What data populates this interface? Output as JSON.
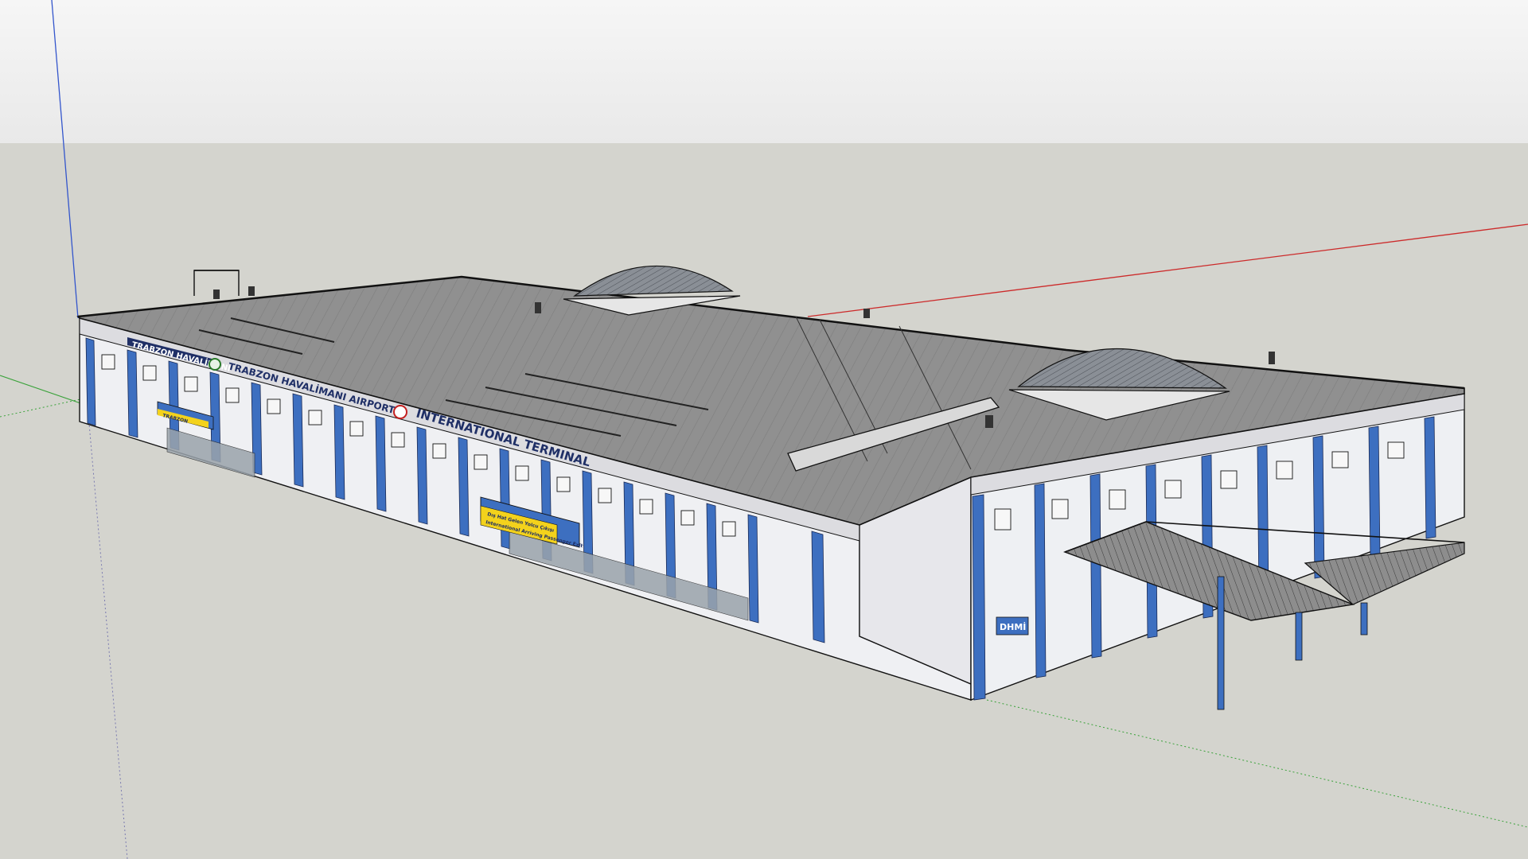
{
  "viewport": {
    "sky_color": "#eeeeee",
    "ground_color": "#d4d4ce"
  },
  "axes": {
    "red_axis_color": "#cc2a2a",
    "green_axis_color": "#3aa23a",
    "blue_axis_color": "#3355cc"
  },
  "colors": {
    "roof": "#8f8f8f",
    "roof_dark": "#7b7b7b",
    "wall_panel": "#f1f1f4",
    "wall_panel_shadow": "#d8d8dc",
    "column_blue": "#3d6fc0",
    "column_blue_dark": "#2f5aa3",
    "sign_navy": "#1f2f66",
    "sign_yellow": "#f3d21c",
    "glass": "#9aa3ab",
    "outline": "#111111"
  },
  "model": {
    "signs": {
      "top_left_text": "TRABZON HAVALİMANI",
      "airport_text": "TRABZON HAVALİMANI  AIRPORT",
      "terminal_text": "INTERNATIONAL TERMINAL",
      "canopy_sign_1_line1": "Dış Hat Gelen Yolcu Çıkışı",
      "canopy_sign_1_line2": "International Arriving Passenger Exit",
      "left_canopy_sign": "TRABZON",
      "dhmi_text": "DHMİ"
    }
  }
}
